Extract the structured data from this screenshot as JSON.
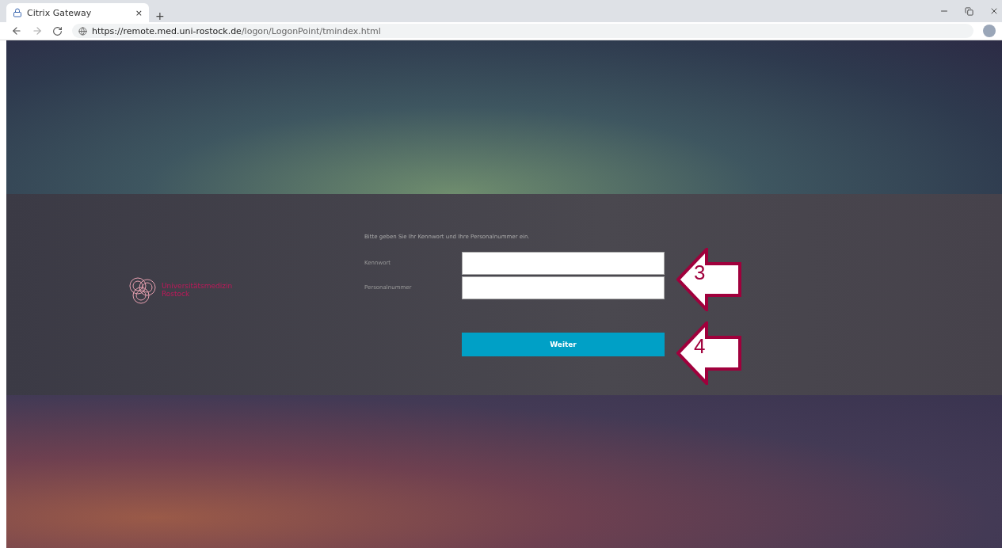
{
  "browser": {
    "tab_title": "Citrix Gateway",
    "tab_close": "×",
    "new_tab": "+",
    "url_host": "https://remote.med.uni-rostock.de",
    "url_path": "/logon/LogonPoint/tmindex.html"
  },
  "logo": {
    "line_1": "Universitätsmedizin",
    "line_2": "Rostock"
  },
  "login": {
    "instruction": "Bitte geben Sie Ihr Kennwort und Ihre Personalnummer ein.",
    "fields": [
      {
        "label": "Kennwort"
      },
      {
        "label": "Personalnummer"
      }
    ],
    "button": "Weiter"
  },
  "callouts": [
    {
      "number": "3"
    },
    {
      "number": "4"
    }
  ]
}
